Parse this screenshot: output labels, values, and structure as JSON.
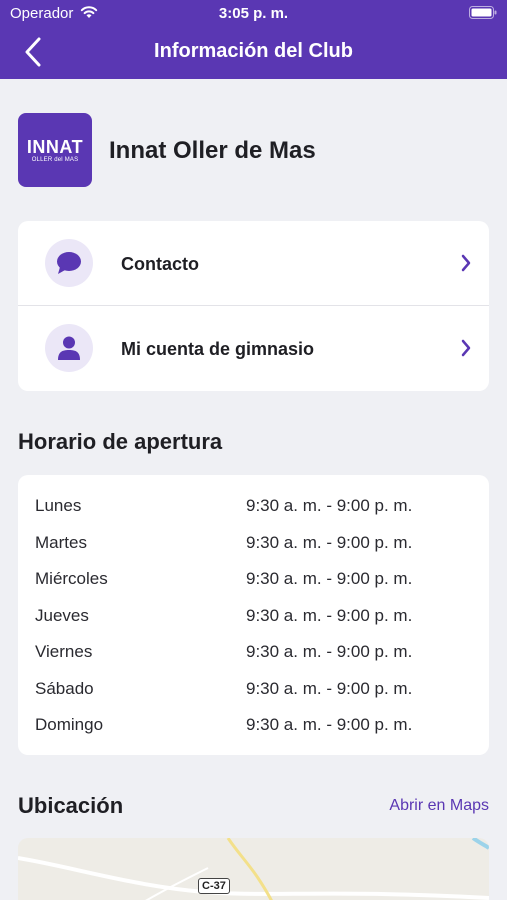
{
  "status_bar": {
    "carrier": "Operador",
    "time": "3:05 p. m."
  },
  "nav": {
    "title": "Información del Club"
  },
  "club": {
    "logo_main": "INNAT",
    "logo_sub": "OLLER del MAS",
    "name": "Innat Oller de Mas"
  },
  "menu": {
    "items": [
      {
        "label": "Contacto",
        "icon": "chat-bubble-icon"
      },
      {
        "label": "Mi cuenta de gimnasio",
        "icon": "person-icon"
      }
    ]
  },
  "hours": {
    "title": "Horario de apertura",
    "rows": [
      {
        "day": "Lunes",
        "time": "9:30 a. m. - 9:00 p. m."
      },
      {
        "day": "Martes",
        "time": "9:30 a. m. - 9:00 p. m."
      },
      {
        "day": "Miércoles",
        "time": "9:30 a. m. - 9:00 p. m."
      },
      {
        "day": "Jueves",
        "time": "9:30 a. m. - 9:00 p. m."
      },
      {
        "day": "Viernes",
        "time": "9:30 a. m. - 9:00 p. m."
      },
      {
        "day": "Sábado",
        "time": "9:30 a. m. - 9:00 p. m."
      },
      {
        "day": "Domingo",
        "time": "9:30 a. m. - 9:00 p. m."
      }
    ]
  },
  "location": {
    "title": "Ubicación",
    "maps_link": "Abrir en Maps",
    "road_label": "C-37"
  },
  "colors": {
    "brand": "#5a37b3",
    "icon_bg": "#ebe7f7",
    "background": "#eff0f4"
  }
}
